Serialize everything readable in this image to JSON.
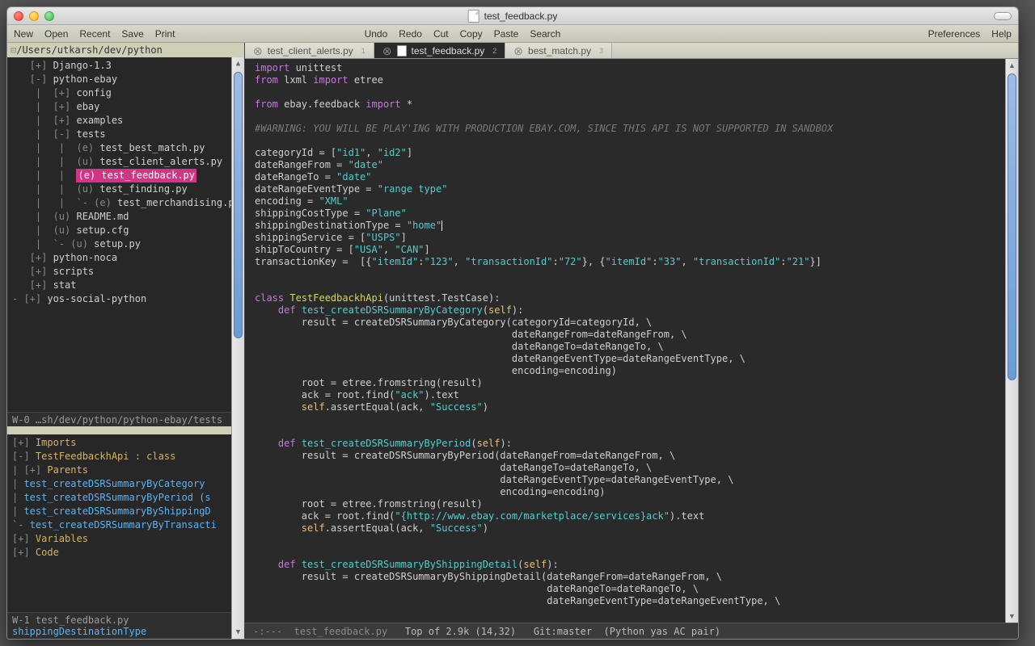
{
  "title": "test_feedback.py",
  "menubar": {
    "left": [
      "New",
      "Open",
      "Recent",
      "Save",
      "Print"
    ],
    "mid": [
      "Undo",
      "Redo",
      "Cut",
      "Copy",
      "Paste",
      "Search"
    ],
    "right": [
      "Preferences",
      "Help"
    ]
  },
  "sidebar": {
    "root": "/Users/utkarsh/dev/python",
    "tree": [
      {
        "d": 0,
        "t": "[+]",
        "n": "Django-1.3"
      },
      {
        "d": 0,
        "t": "[-]",
        "n": "python-ebay"
      },
      {
        "d": 1,
        "t": "[+]",
        "n": "config"
      },
      {
        "d": 1,
        "t": "[+]",
        "n": "ebay"
      },
      {
        "d": 1,
        "t": "[+]",
        "n": "examples"
      },
      {
        "d": 1,
        "t": "[-]",
        "n": "tests"
      },
      {
        "d": 2,
        "t": "(e)",
        "n": "test_best_match.py"
      },
      {
        "d": 2,
        "t": "(u)",
        "n": "test_client_alerts.py"
      },
      {
        "d": 2,
        "t": "(e)",
        "n": "test_feedback.py",
        "sel": true
      },
      {
        "d": 2,
        "t": "(u)",
        "n": "test_finding.py"
      },
      {
        "d": 2,
        "t": "(e)",
        "n": "test_merchandising.py",
        "last": true
      },
      {
        "d": 1,
        "t": "(u)",
        "n": "README.md"
      },
      {
        "d": 1,
        "t": "(u)",
        "n": "setup.cfg"
      },
      {
        "d": 1,
        "t": "(u)",
        "n": "setup.py",
        "last": true
      },
      {
        "d": 0,
        "t": "[+]",
        "n": "python-noca"
      },
      {
        "d": 0,
        "t": "[+]",
        "n": "scripts"
      },
      {
        "d": 0,
        "t": "[+]",
        "n": "stat"
      },
      {
        "d": 0,
        "t": "[+]",
        "n": "yos-social-python",
        "root": true
      }
    ],
    "status": "W-0 …sh/dev/python/python-ebay/tests",
    "outline": {
      "items": [
        {
          "t": "[+]",
          "txt": "Imports",
          "c": "y"
        },
        {
          "t": "[-]",
          "txt": "TestFeedbackhApi : class",
          "c": "y"
        },
        {
          "t": "| [+]",
          "txt": "Parents",
          "c": "y",
          "d": 1
        },
        {
          "t": "|",
          "txt": "test_createDSRSummaryByCategory",
          "c": "bl",
          "d": 1
        },
        {
          "t": "|",
          "txt": "test_createDSRSummaryByPeriod (s",
          "c": "bl",
          "d": 1
        },
        {
          "t": "|",
          "txt": "test_createDSRSummaryByShippingD",
          "c": "bl",
          "d": 1
        },
        {
          "t": "`-",
          "txt": "test_createDSRSummaryByTransacti",
          "c": "bl",
          "d": 1
        },
        {
          "t": "[+]",
          "txt": "Variables",
          "c": "y"
        },
        {
          "t": "[+]",
          "txt": "Code",
          "c": "y"
        }
      ],
      "bot1": "W-1 test_feedback.py",
      "bot2": "shippingDestinationType"
    }
  },
  "tabs": [
    {
      "label": "test_client_alerts.py",
      "num": "1"
    },
    {
      "label": "test_feedback.py",
      "num": "2",
      "active": true
    },
    {
      "label": "best_match.py",
      "num": "3"
    }
  ],
  "code": [
    [
      [
        "kw",
        "import"
      ],
      [
        "id",
        " unittest"
      ]
    ],
    [
      [
        "kw",
        "from"
      ],
      [
        "id",
        " lxml "
      ],
      [
        "kw",
        "import"
      ],
      [
        "id",
        " etree"
      ]
    ],
    [],
    [
      [
        "kw",
        "from"
      ],
      [
        "id",
        " ebay.feedback "
      ],
      [
        "kw",
        "import"
      ],
      [
        "id",
        " *"
      ]
    ],
    [],
    [
      [
        "cm",
        "#WARNING: YOU WILL BE PLAY'ING WITH PRODUCTION EBAY.COM, SINCE THIS API IS NOT SUPPORTED IN SANDBOX"
      ]
    ],
    [],
    [
      [
        "id",
        "categoryId = ["
      ],
      [
        "str",
        "\"id1\""
      ],
      [
        "id",
        ", "
      ],
      [
        "str",
        "\"id2\""
      ],
      [
        "id",
        "]"
      ]
    ],
    [
      [
        "id",
        "dateRangeFrom = "
      ],
      [
        "str",
        "\"date\""
      ]
    ],
    [
      [
        "id",
        "dateRangeTo = "
      ],
      [
        "str",
        "\"date\""
      ]
    ],
    [
      [
        "id",
        "dateRangeEventType = "
      ],
      [
        "str",
        "\"range type\""
      ]
    ],
    [
      [
        "id",
        "encoding = "
      ],
      [
        "str",
        "\"XML\""
      ]
    ],
    [
      [
        "id",
        "shippingCostType = "
      ],
      [
        "str",
        "\"Plane\""
      ]
    ],
    [
      [
        "id",
        "shippingDestinationType = "
      ],
      [
        "str",
        "\"home\""
      ],
      [
        "cur",
        ""
      ]
    ],
    [
      [
        "id",
        "shippingService = ["
      ],
      [
        "str",
        "\"USPS\""
      ],
      [
        "id",
        "]"
      ]
    ],
    [
      [
        "id",
        "shipToCountry = ["
      ],
      [
        "str",
        "\"USA\""
      ],
      [
        "id",
        ", "
      ],
      [
        "str",
        "\"CAN\""
      ],
      [
        "id",
        "]"
      ]
    ],
    [
      [
        "id",
        "transactionKey =  [{"
      ],
      [
        "str",
        "\"itemId\""
      ],
      [
        "id",
        ":"
      ],
      [
        "str",
        "\"123\""
      ],
      [
        "id",
        ", "
      ],
      [
        "str",
        "\"transactionId\""
      ],
      [
        "id",
        ":"
      ],
      [
        "str",
        "\"72\""
      ],
      [
        "id",
        "}, {"
      ],
      [
        "str",
        "\"itemId\""
      ],
      [
        "id",
        ":"
      ],
      [
        "str",
        "\"33\""
      ],
      [
        "id",
        ", "
      ],
      [
        "str",
        "\"transactionId\""
      ],
      [
        "id",
        ":"
      ],
      [
        "str",
        "\"21\""
      ],
      [
        "id",
        "}]"
      ]
    ],
    [],
    [],
    [
      [
        "kw",
        "class"
      ],
      [
        "cls",
        " TestFeedbackhApi"
      ],
      [
        "id",
        "(unittest.TestCase):"
      ]
    ],
    [
      [
        "id",
        "    "
      ],
      [
        "kw",
        "def"
      ],
      [
        "fn",
        " test_createDSRSummaryByCategory"
      ],
      [
        "id",
        "("
      ],
      [
        "hl",
        "self"
      ],
      [
        "id",
        "):"
      ]
    ],
    [
      [
        "id",
        "        result = createDSRSummaryByCategory(categoryId=categoryId, \\"
      ]
    ],
    [
      [
        "id",
        "                                            dateRangeFrom=dateRangeFrom, \\"
      ]
    ],
    [
      [
        "id",
        "                                            dateRangeTo=dateRangeTo, \\"
      ]
    ],
    [
      [
        "id",
        "                                            dateRangeEventType=dateRangeEventType, \\"
      ]
    ],
    [
      [
        "id",
        "                                            encoding=encoding)"
      ]
    ],
    [
      [
        "id",
        "        root = etree.fromstring(result)"
      ]
    ],
    [
      [
        "id",
        "        ack = root.find("
      ],
      [
        "str",
        "\"ack\""
      ],
      [
        "id",
        ").text"
      ]
    ],
    [
      [
        "id",
        "        "
      ],
      [
        "hl",
        "self"
      ],
      [
        "id",
        ".assertEqual(ack, "
      ],
      [
        "str",
        "\"Success\""
      ],
      [
        "id",
        ")"
      ]
    ],
    [],
    [],
    [
      [
        "id",
        "    "
      ],
      [
        "kw",
        "def"
      ],
      [
        "fn",
        " test_createDSRSummaryByPeriod"
      ],
      [
        "id",
        "("
      ],
      [
        "hl",
        "self"
      ],
      [
        "id",
        "):"
      ]
    ],
    [
      [
        "id",
        "        result = createDSRSummaryByPeriod(dateRangeFrom=dateRangeFrom, \\"
      ]
    ],
    [
      [
        "id",
        "                                          dateRangeTo=dateRangeTo, \\"
      ]
    ],
    [
      [
        "id",
        "                                          dateRangeEventType=dateRangeEventType, \\"
      ]
    ],
    [
      [
        "id",
        "                                          encoding=encoding)"
      ]
    ],
    [
      [
        "id",
        "        root = etree.fromstring(result)"
      ]
    ],
    [
      [
        "id",
        "        ack = root.find("
      ],
      [
        "str",
        "\"{http://www.ebay.com/marketplace/services}ack\""
      ],
      [
        "id",
        ").text"
      ]
    ],
    [
      [
        "id",
        "        "
      ],
      [
        "hl",
        "self"
      ],
      [
        "id",
        ".assertEqual(ack, "
      ],
      [
        "str",
        "\"Success\""
      ],
      [
        "id",
        ")"
      ]
    ],
    [],
    [],
    [
      [
        "id",
        "    "
      ],
      [
        "kw",
        "def"
      ],
      [
        "fn",
        " test_createDSRSummaryByShippingDetail"
      ],
      [
        "id",
        "("
      ],
      [
        "hl",
        "self"
      ],
      [
        "id",
        "):"
      ]
    ],
    [
      [
        "id",
        "        result = createDSRSummaryByShippingDetail(dateRangeFrom=dateRangeFrom, \\"
      ]
    ],
    [
      [
        "id",
        "                                                  dateRangeTo=dateRangeTo, \\"
      ]
    ],
    [
      [
        "id",
        "                                                  dateRangeEventType=dateRangeEventType, \\"
      ]
    ]
  ],
  "status": {
    "left": "-:---",
    "file": "test_feedback.py",
    "pos": "Top of 2.9k (14,32)",
    "git": "Git:master",
    "modes": "(Python yas AC pair)"
  }
}
